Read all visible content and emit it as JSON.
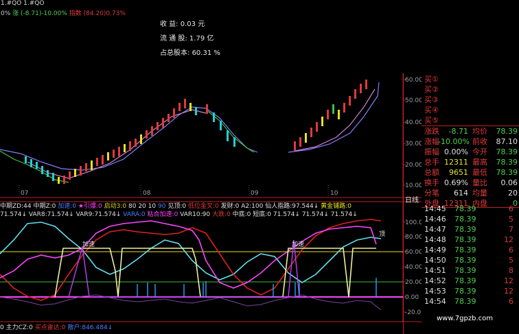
{
  "header": {
    "line1": "1.#QO 1.#QO",
    "line2_prefix": "0%",
    "line2_zhang": "涨 (-8.71)-10.00%",
    "line2_index": "指数 (84.20)0.73%"
  },
  "info": {
    "income_label": "收    益:",
    "income_value": "0.03 元",
    "float_label": "流 通 股:",
    "float_value": "1.79 亿",
    "share_label": "占总股本:",
    "share_value": "60.31 %"
  },
  "main_axis": {
    "ticks": [
      "60.00",
      "50.00",
      "40.00",
      "30.00",
      "20.00",
      "10.00",
      "日线"
    ],
    "months": [
      "07",
      "08",
      "09",
      "10"
    ]
  },
  "indicator_bar": {
    "row1": [
      {
        "text": "中期ZD:44",
        "color": "#e0e0e0"
      },
      {
        "text": "中期Z:0",
        "color": "#e0e0e0"
      },
      {
        "text": "加速:0",
        "color": "#4a7dff"
      },
      {
        "text": "★引爆:0",
        "color": "#ff44ff"
      },
      {
        "text": "启动3:0",
        "color": "#d0d020"
      },
      {
        "text": "80",
        "color": "#e0e0e0"
      },
      {
        "text": "20",
        "color": "#e0e0e0"
      },
      {
        "text": "10",
        "color": "#e0e0e0"
      },
      {
        "text": "90",
        "color": "#4a7dff"
      },
      {
        "text": "见顶:0",
        "color": "#e0e0e0"
      },
      {
        "text": "低位金叉:0",
        "color": "#e13a3a"
      },
      {
        "text": "发财:0",
        "color": "#e0e0e0"
      },
      {
        "text": "A2:100",
        "color": "#e0e0e0"
      },
      {
        "text": "仙人指路:97.544↓",
        "color": "#e0e0e0"
      },
      {
        "text": "黄金铺路:0",
        "color": "#e8e020"
      }
    ],
    "row2": [
      {
        "text": "71.574↓",
        "color": "#e0e0e0"
      },
      {
        "text": "VAR8:71.574↓",
        "color": "#e0e0e0"
      },
      {
        "text": "VAR9:71.574↓",
        "color": "#e0e0e0"
      },
      {
        "text": "VARA:0",
        "color": "#4a7dff"
      },
      {
        "text": "粘合加速:0",
        "color": "#ff44ff"
      },
      {
        "text": "VAR10:90",
        "color": "#e0e0e0"
      },
      {
        "text": "大跌:0",
        "color": "#e13a3a"
      },
      {
        "text": "中底:0",
        "color": "#e0e0e0"
      },
      {
        "text": "短底:0",
        "color": "#e0e0e0"
      },
      {
        "text": "71.574↓",
        "color": "#e0e0e0"
      },
      {
        "text": "71.574↓",
        "color": "#e0e0e0"
      },
      {
        "text": "71.574↓",
        "color": "#e0e0e0"
      }
    ]
  },
  "ind_axis": {
    "ticks": [
      "100.00",
      "80.00",
      "60.00",
      "40.00",
      "20.00",
      "0.00",
      "-20.00"
    ],
    "labels": [
      "加速",
      "加速",
      "顶"
    ]
  },
  "bottom_bar": [
    {
      "text": "0",
      "color": "#e0e0e0"
    },
    {
      "text": "主力CZ:0",
      "color": "#e0e0e0"
    },
    {
      "text": "买点雷达:0",
      "color": "#e13a3a"
    },
    {
      "text": "散户:846.484↓",
      "color": "#4a7dff"
    }
  ],
  "quote": {
    "buys": [
      "买①",
      "买②",
      "买③",
      "买④",
      "买⑤"
    ],
    "rows": [
      {
        "l1": "涨跌",
        "v1": "-8.71",
        "l2": "均价",
        "v2": "78.39"
      },
      {
        "l1": "涨幅",
        "v1": "-10.00%",
        "l2": "前收",
        "v2": "87.10"
      },
      {
        "l1": "振幅",
        "v1": "0.00%",
        "l2": "今开",
        "v2": "78.39"
      },
      {
        "l1": "总手",
        "v1": "12311",
        "l2": "最高",
        "v2": "78.39"
      },
      {
        "l1": "总额",
        "v1": "9651",
        "l2": "最低",
        "v2": "78.39"
      },
      {
        "l1": "换手",
        "v1": "0.69%",
        "l2": "量比",
        "v2": "0.06"
      },
      {
        "l1": "分笔",
        "v1": "614",
        "l2": "均量",
        "v2": "20"
      },
      {
        "l1": "外盘",
        "v1": "12311",
        "l2": "内盘",
        "v2": "0"
      }
    ],
    "ticks": [
      {
        "time": "14:45",
        "price": "78.39",
        "vol": "6"
      },
      {
        "time": "14:46",
        "price": "78.39",
        "vol": "5"
      },
      {
        "time": "14:47",
        "price": "78.39",
        "vol": "7"
      },
      {
        "time": "14:48",
        "price": "78.39",
        "vol": "12"
      },
      {
        "time": "14:49",
        "price": "78.39",
        "vol": "6"
      },
      {
        "time": "14:50",
        "price": "78.39",
        "vol": "5"
      },
      {
        "time": "14:51",
        "price": "78.39",
        "vol": "8"
      },
      {
        "time": "14:52",
        "price": "78.39",
        "vol": "12"
      },
      {
        "time": "14:53",
        "price": "78.39",
        "vol": "12"
      },
      {
        "time": "14:54",
        "price": "78.39",
        "vol": "6"
      }
    ]
  },
  "watermark": "www.7gpzb.com",
  "colors": {
    "up": "#e13a3a",
    "down": "#1fd1d1",
    "text": "#c8c8c8",
    "yellow": "#e8e020",
    "blue": "#4a7dff"
  }
}
